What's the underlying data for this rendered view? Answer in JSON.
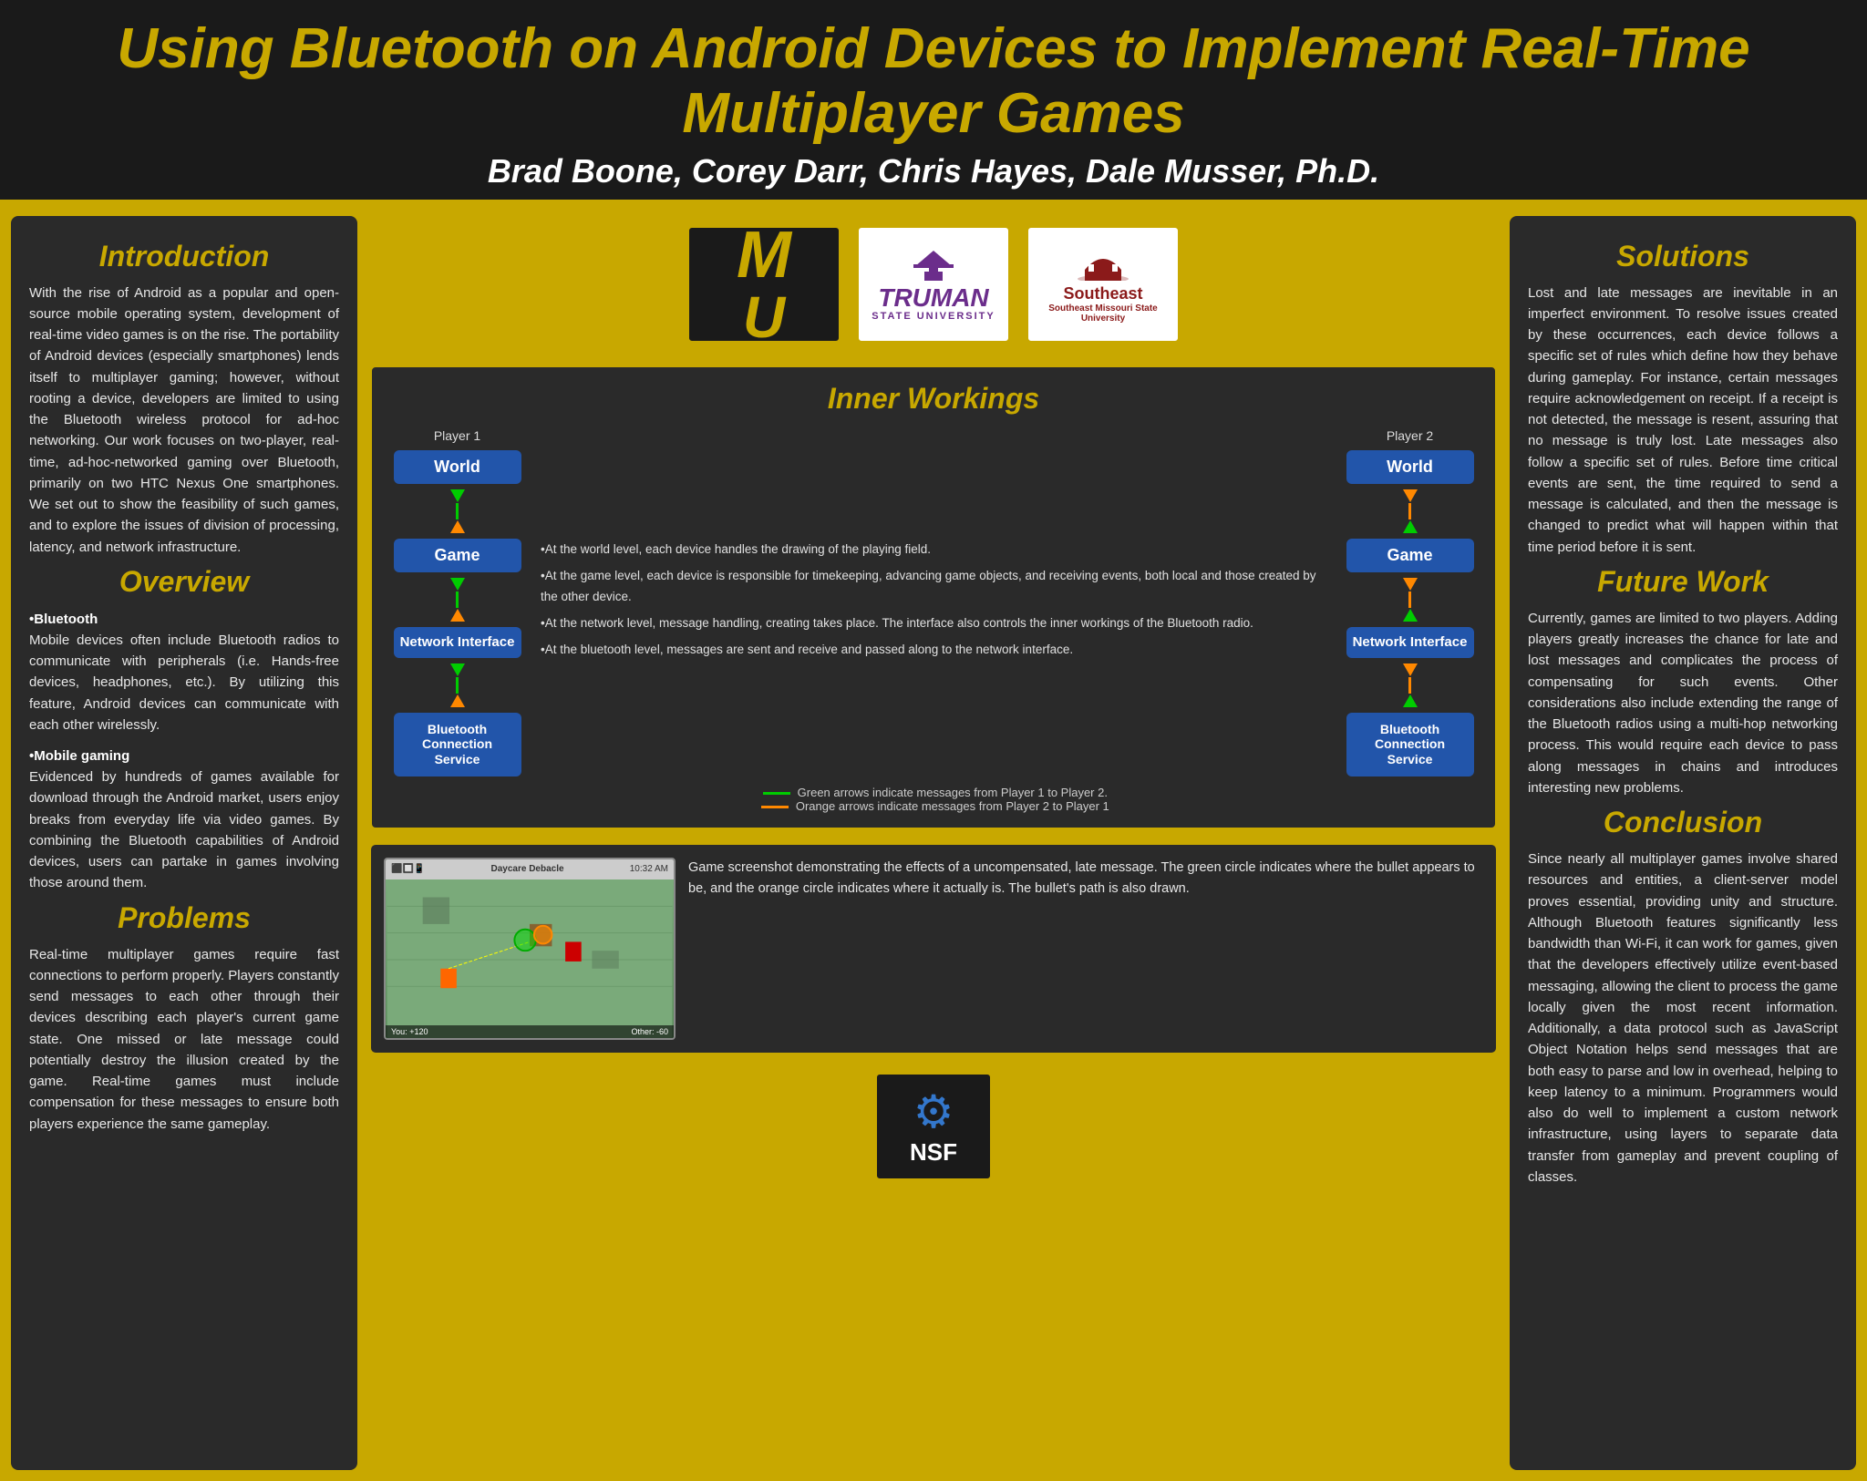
{
  "header": {
    "title": "Using Bluetooth on Android Devices to Implement Real-Time Multiplayer Games",
    "authors": "Brad Boone, Corey Darr, Chris Hayes, Dale Musser, Ph.D."
  },
  "logos": {
    "mu": "MU",
    "truman": "TRUMAN STATE UNIVERSITY",
    "southeast": "Southeast Missouri State University",
    "nsf": "NSF"
  },
  "left_col": {
    "introduction": {
      "title": "Introduction",
      "body": "With the rise of Android as a popular and open-source mobile operating system, development of real-time video games is on the rise. The portability of Android devices (especially smartphones) lends itself to multiplayer gaming; however, without rooting a device, developers are limited to using the Bluetooth wireless protocol for ad-hoc networking. Our work focuses on two-player, real-time, ad-hoc-networked gaming over Bluetooth, primarily on two HTC Nexus One smartphones. We set out to show the feasibility of such games, and to explore the issues of division of processing, latency, and network infrastructure."
    },
    "overview": {
      "title": "Overview",
      "bluetooth_head": "•Bluetooth",
      "bluetooth_body": "Mobile devices often include Bluetooth radios to communicate with peripherals (i.e. Hands-free devices, headphones, etc.). By utilizing this feature, Android devices can communicate with each other wirelessly.",
      "mobile_head": "•Mobile gaming",
      "mobile_body": "Evidenced by hundreds of games available for download through the Android market, users enjoy breaks from everyday life via video games. By combining the Bluetooth capabilities of Android devices, users can partake in games involving those around them."
    },
    "problems": {
      "title": "Problems",
      "body": "Real-time multiplayer games require fast connections to perform properly. Players constantly send messages to each other through their devices describing each player's current game state. One missed or late message could potentially destroy the illusion created by the game. Real-time games must include compensation for these messages to ensure both players experience the same gameplay."
    }
  },
  "center": {
    "inner_workings": {
      "title": "Inner Workings",
      "player1_label": "Player 1",
      "player2_label": "Player 2",
      "world_label": "World",
      "game_label": "Game",
      "network_interface_label": "Network Interface",
      "bluetooth_label": "Bluetooth Connection Service",
      "bullet1": "•At the world level, each device handles the drawing of the playing field.",
      "bullet2": "•At the game level, each device is responsible for timekeeping, advancing game objects, and receiving events, both local and those created by the other device.",
      "bullet3": "•At the network level, message handling, creating takes place. The interface also controls the inner workings of the Bluetooth radio.",
      "bullet4": "•At the bluetooth level, messages are sent and receive and passed along to the network interface.",
      "legend_green": "Green arrows indicate messages from Player 1 to Player 2.",
      "legend_orange": "Orange arrows indicate messages from Player 2 to Player 1"
    },
    "screenshot": {
      "caption": "Game screenshot demonstrating the effects of a uncompensated, late message. The green circle indicates where the bullet appears to be, and the orange circle indicates where it actually is. The bullet's path is also drawn."
    }
  },
  "right_col": {
    "solutions": {
      "title": "Solutions",
      "body": "Lost and late messages are inevitable in an imperfect environment. To resolve issues created by these occurrences, each device follows a specific set of rules which define how they behave during gameplay. For instance, certain messages require acknowledgement on receipt. If a receipt is not detected, the message is resent, assuring that no message is truly lost. Late messages also follow a specific set of rules. Before time critical events are sent, the time required to send a message is calculated, and then the message is changed to predict what will happen within that time period before it is sent."
    },
    "future_work": {
      "title": "Future Work",
      "body": "Currently, games are limited to two players. Adding players greatly increases the chance for late and lost messages and complicates the process of compensating for such events. Other considerations also include extending the range of the Bluetooth radios using a multi-hop networking process. This would require each device to pass along messages in chains and introduces interesting new problems."
    },
    "conclusion": {
      "title": "Conclusion",
      "body": "Since nearly all multiplayer games involve shared resources and entities, a client-server model proves essential, providing unity and structure. Although Bluetooth features significantly less bandwidth than Wi-Fi, it can work for games, given that the developers effectively utilize event-based messaging, allowing the client to process the game locally given the most recent information. Additionally, a data protocol such as JavaScript Object Notation helps send messages that are both easy to parse and low in overhead, helping to keep latency to a minimum. Programmers would also do well to implement a custom network infrastructure, using layers to separate data transfer from gameplay and prevent coupling of classes."
    }
  }
}
